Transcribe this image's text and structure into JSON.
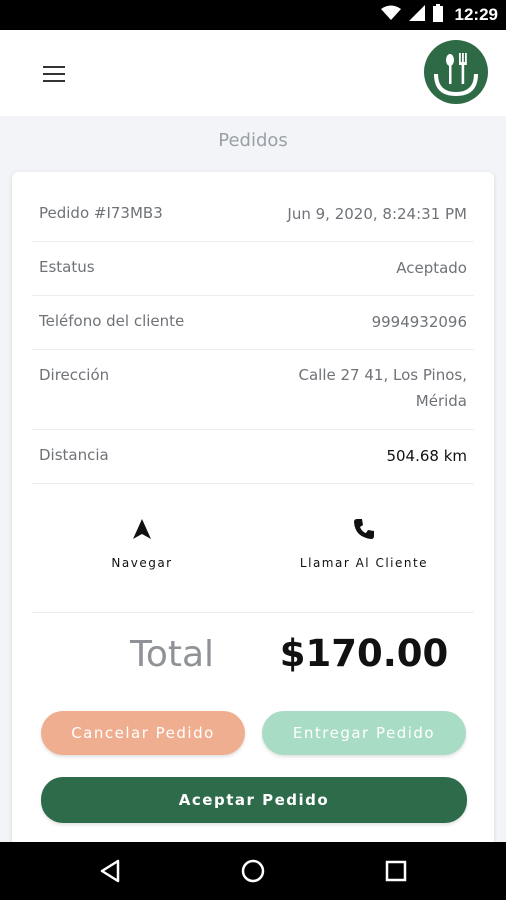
{
  "status_bar": {
    "time": "12:29",
    "icons": [
      "wifi-icon",
      "cell-signal-icon",
      "battery-icon"
    ]
  },
  "app_bar": {
    "menu_icon": "hamburger-menu-icon",
    "logo_icon": "fork-knife-logo-icon"
  },
  "page": {
    "title": "Pedidos"
  },
  "order": {
    "rows": [
      {
        "label": "Pedido #I73MB3",
        "value": "Jun 9, 2020, 8:24:31 PM"
      },
      {
        "label": "Estatus",
        "value": "Aceptado"
      },
      {
        "label": "Teléfono del cliente",
        "value": "9994932096"
      },
      {
        "label": "Dirección",
        "value_line1": "Calle 27 41, Los Pinos,",
        "value_line2": "Mérida"
      },
      {
        "label": "Distancia",
        "value": "504.68 km"
      }
    ],
    "actions": [
      {
        "label": "Navegar",
        "icon": "navigation-arrow-icon"
      },
      {
        "label": "Llamar Al Cliente",
        "icon": "phone-icon"
      }
    ],
    "total_label": "Total",
    "total_value": "$170.00",
    "buttons": {
      "cancel": "Cancelar Pedido",
      "deliver": "Entregar Pedido",
      "accept": "Aceptar Pedido"
    }
  },
  "colors": {
    "brand_green": "#2e6b4a",
    "cancel": "#f0ae90",
    "deliver": "#a8dcc4"
  },
  "nav_bar": {
    "buttons": [
      "back-icon",
      "home-icon",
      "recents-icon"
    ]
  }
}
